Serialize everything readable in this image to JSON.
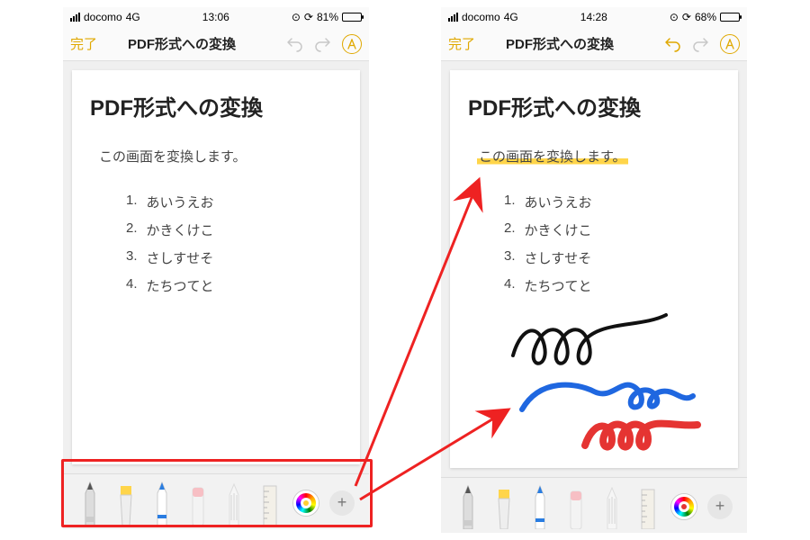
{
  "status": {
    "carrier": "docomo",
    "network": "4G",
    "alarm_glyph": "⊙",
    "refresh_glyph": "⟳"
  },
  "left": {
    "time": "13:06",
    "battery": "81%"
  },
  "right": {
    "time": "14:28",
    "battery": "68%"
  },
  "nav": {
    "done": "完了",
    "title": "PDF形式への変換"
  },
  "doc": {
    "title": "PDF形式への変換",
    "subtitle": "この画面を変換します。",
    "items": [
      "あいうえお",
      "かきくけこ",
      "さしすせそ",
      "たちつてと"
    ]
  },
  "tools": {
    "plus": "+",
    "markup": "A"
  },
  "colors": {
    "arrow": "#e22",
    "scribble_black": "#111",
    "scribble_blue": "#1f67e0",
    "scribble_red": "#e53432"
  }
}
